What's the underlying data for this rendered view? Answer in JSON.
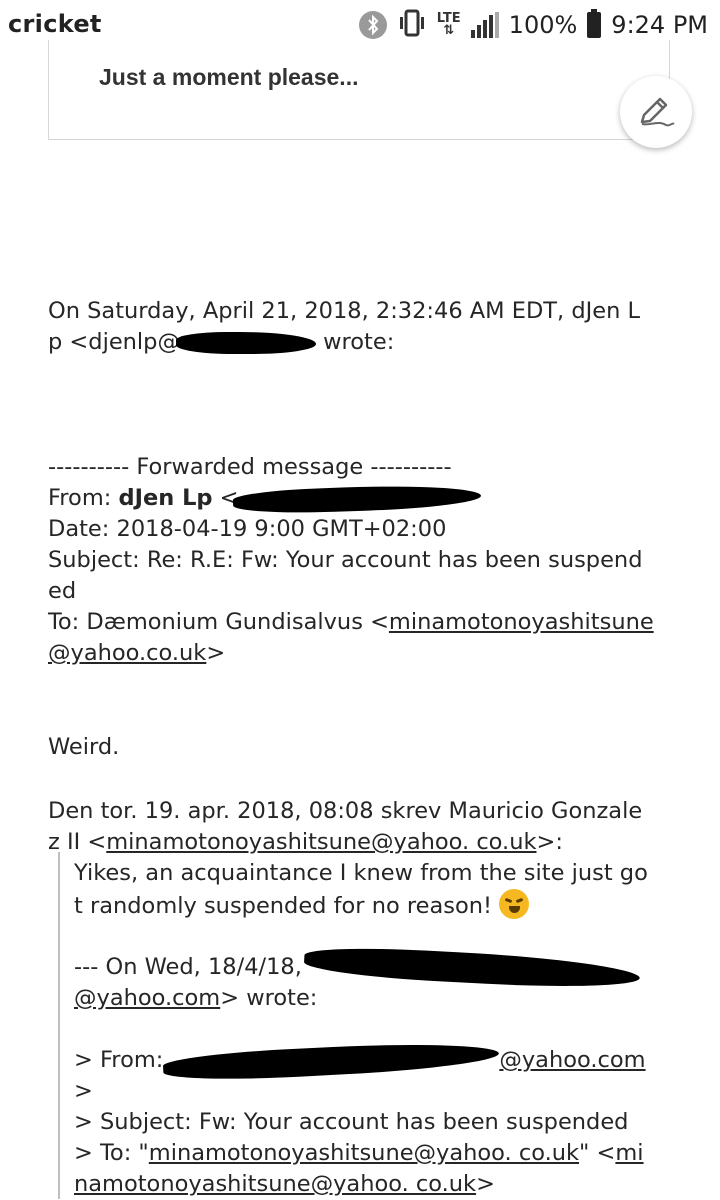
{
  "status_bar": {
    "carrier": "cricket",
    "network": "LTE",
    "battery": "100%",
    "time": "9:24 PM"
  },
  "loading_card": {
    "text": "Just a moment please..."
  },
  "compose_fab": {
    "icon": "pencil-icon"
  },
  "email": {
    "header_line1": "On Saturday, April 21, 2018, 2:32:46 AM EDT, dJen L",
    "header_line2_prefix": "p <djenlp@",
    "header_line2_suffix": "wrote:",
    "forward_divider": "---------- Forwarded message ----------",
    "from_label": "From: ",
    "from_name": "dJen Lp",
    "from_email_prefix": " <",
    "date_line": "Date: 2018-04-19 9:00 GMT+02:00",
    "subject_line1": "Subject: Re: R.E: Fw: Your account has been suspend",
    "subject_line2": "ed",
    "to_prefix": "To: Dæmonium Gundisalvus <",
    "to_email_part1": "minamotonoyashitsune",
    "to_email_part2": "@yahoo.co.uk",
    "to_suffix": ">",
    "body_weird": "Weird.",
    "reply_header_line1": "Den tor. 19. apr. 2018, 08:08 skrev Mauricio Gonzale",
    "reply_header_line2_prefix": "z II <",
    "reply_header_email": "minamotonoyashitsune@yahoo. co.uk",
    "reply_header_line2_suffix": ">:",
    "quote_line1": "Yikes, an acquaintance I knew from the site just go",
    "quote_line2": "t randomly suspended for no reason! ",
    "quote_emoji": "grinning-face-emoji",
    "nested_header_prefix": "--- On Wed, 18/4/18,",
    "nested_header_tail": "@yahoo.com",
    "nested_header_suffix": "> wrote:",
    "nested_from_prefix": "> From:",
    "nested_from_email": "@yahoo.com",
    "nested_gt": ">",
    "nested_subject": "> Subject: Fw: Your account has been suspended",
    "nested_to_prefix": "> To: \"",
    "nested_to_email1": "minamotonoyashitsune@yahoo. co.uk",
    "nested_to_mid": "\" <",
    "nested_to_email2_part1": "mi",
    "nested_to_email2_part2": "namotonoyashitsune@yahoo. co.uk",
    "nested_to_suffix": ">"
  }
}
